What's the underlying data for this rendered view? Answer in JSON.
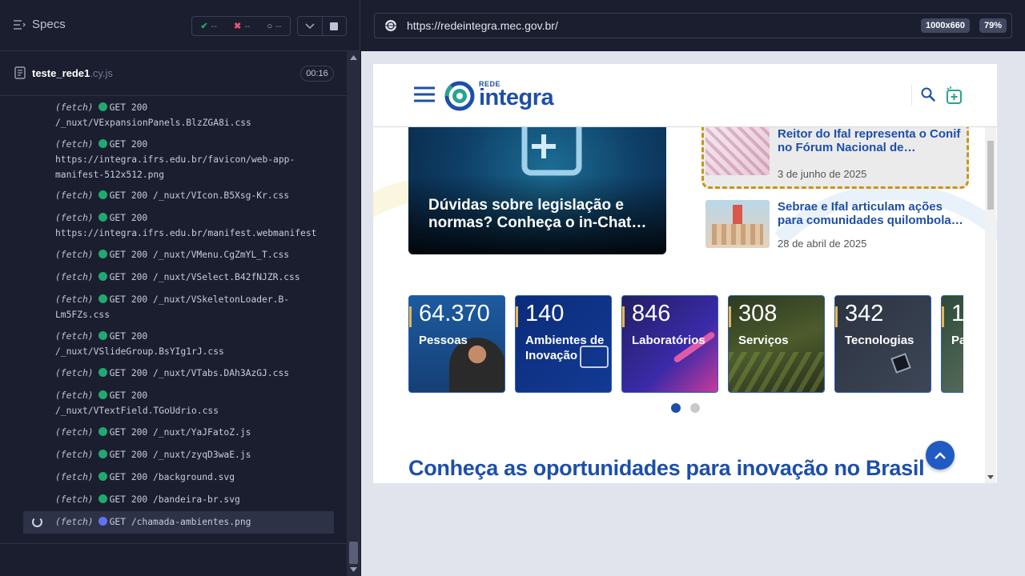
{
  "runner": {
    "specs_label": "Specs",
    "stats": {
      "passed": "--",
      "failed": "--",
      "pending": "--"
    },
    "spec_file": {
      "name": "teste_rede1",
      "ext": ".cy.js",
      "time": "00:16"
    },
    "log": [
      {
        "kind": "(fetch)",
        "line1": "GET 200",
        "line2": "/_nuxt/VExpansionPanels.BlzZGA8i.css"
      },
      {
        "kind": "(fetch)",
        "line1": "GET 200",
        "line2": "https://integra.ifrs.edu.br/favicon/web-app-manifest-512x512.png"
      },
      {
        "kind": "(fetch)",
        "line1": "GET 200 /_nuxt/VIcon.B5Xsg-Kr.css",
        "line2": ""
      },
      {
        "kind": "(fetch)",
        "line1": "GET 200",
        "line2": "https://integra.ifrs.edu.br/manifest.webmanifest"
      },
      {
        "kind": "(fetch)",
        "line1": "GET 200 /_nuxt/VMenu.CgZmYL_T.css",
        "line2": ""
      },
      {
        "kind": "(fetch)",
        "line1": "GET 200 /_nuxt/VSelect.B42fNJZR.css",
        "line2": ""
      },
      {
        "kind": "(fetch)",
        "line1": "GET 200 /_nuxt/VSkeletonLoader.B-",
        "line2": "Lm5FZs.css"
      },
      {
        "kind": "(fetch)",
        "line1": "GET 200",
        "line2": "/_nuxt/VSlideGroup.BsYIg1rJ.css"
      },
      {
        "kind": "(fetch)",
        "line1": "GET 200 /_nuxt/VTabs.DAh3AzGJ.css",
        "line2": ""
      },
      {
        "kind": "(fetch)",
        "line1": "GET 200",
        "line2": "/_nuxt/VTextField.TGoUdrio.css"
      },
      {
        "kind": "(fetch)",
        "line1": "GET 200 /_nuxt/YaJFatoZ.js",
        "line2": ""
      },
      {
        "kind": "(fetch)",
        "line1": "GET 200 /_nuxt/zyqD3waE.js",
        "line2": ""
      },
      {
        "kind": "(fetch)",
        "line1": "GET 200 /background.svg",
        "line2": ""
      },
      {
        "kind": "(fetch)",
        "line1": "GET 200 /bandeira-br.svg",
        "line2": ""
      },
      {
        "kind": "(fetch)",
        "line1": "GET /chamada-ambientes.png",
        "line2": ""
      }
    ]
  },
  "browser": {
    "url": "https://redeintegra.mec.gov.br/",
    "viewport": "1000x660",
    "zoom": "79%"
  },
  "site": {
    "logo_small": "REDE",
    "logo_main": "integra",
    "feature_title": "Dúvidas sobre legislação e normas? Conheça o in-Chat…",
    "news": [
      {
        "title": "Reitor do Ifal representa o Conif no Fórum Nacional de…",
        "date": "3 de junho de 2025"
      },
      {
        "title": "Sebrae e Ifal articulam ações para comunidades quilombola…",
        "date": "28 de abril de 2025"
      }
    ],
    "stats": [
      {
        "num": "64.370",
        "label": "Pessoas"
      },
      {
        "num": "140",
        "label": "Ambientes de Inovação"
      },
      {
        "num": "846",
        "label": "Laboratórios"
      },
      {
        "num": "308",
        "label": "Serviços"
      },
      {
        "num": "342",
        "label": "Tecnologias"
      },
      {
        "num": "1",
        "label": "Pa"
      }
    ],
    "section_title": "Conheça as oportunidades para inovação no Brasil"
  },
  "colors": {
    "runner_bg": "#1b1e2e",
    "brand_blue": "#1d4fa8",
    "highlight_border": "#c8951a",
    "status_green": "#1fa971",
    "pending_purple": "#6470f3"
  }
}
